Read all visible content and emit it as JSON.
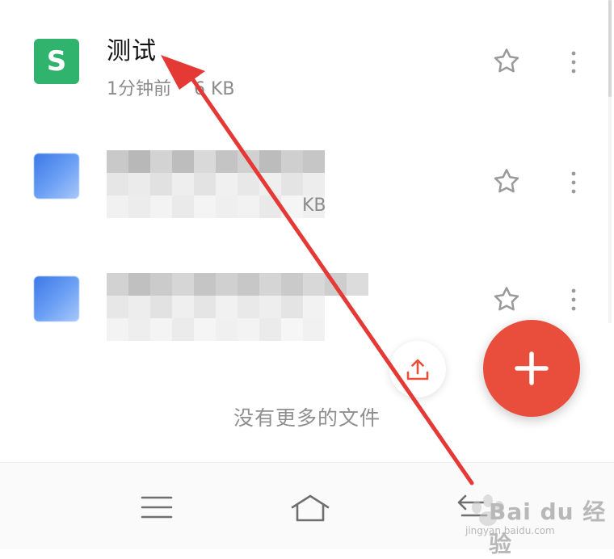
{
  "files": [
    {
      "title": "测试",
      "meta_time": "1分钟前",
      "meta_size": "6 KB",
      "icon": "spreadsheet-s-icon",
      "icon_letter": "S",
      "icon_color": "#2fb36d",
      "blurred": false
    },
    {
      "title": "",
      "meta_time": "",
      "meta_size": "KB",
      "icon": "document-icon",
      "icon_color": "#3b78e7",
      "blurred": true
    },
    {
      "title": "",
      "meta_time": "",
      "meta_size": "",
      "icon": "document-icon",
      "icon_color": "#3b78e7",
      "blurred": true
    }
  ],
  "empty_text": "没有更多的文件",
  "fab": {
    "icon": "plus-icon",
    "color": "#e84e3b"
  },
  "upload": {
    "icon": "upload-icon",
    "color": "#e84e3b"
  },
  "nav": {
    "menu_icon": "menu-icon",
    "home_icon": "home-icon",
    "back_icon": "back-icon"
  },
  "annotation": {
    "color": "#e53935"
  },
  "watermark": {
    "brand": "Bai du 经验",
    "url": "jingyan.baidu.com"
  }
}
